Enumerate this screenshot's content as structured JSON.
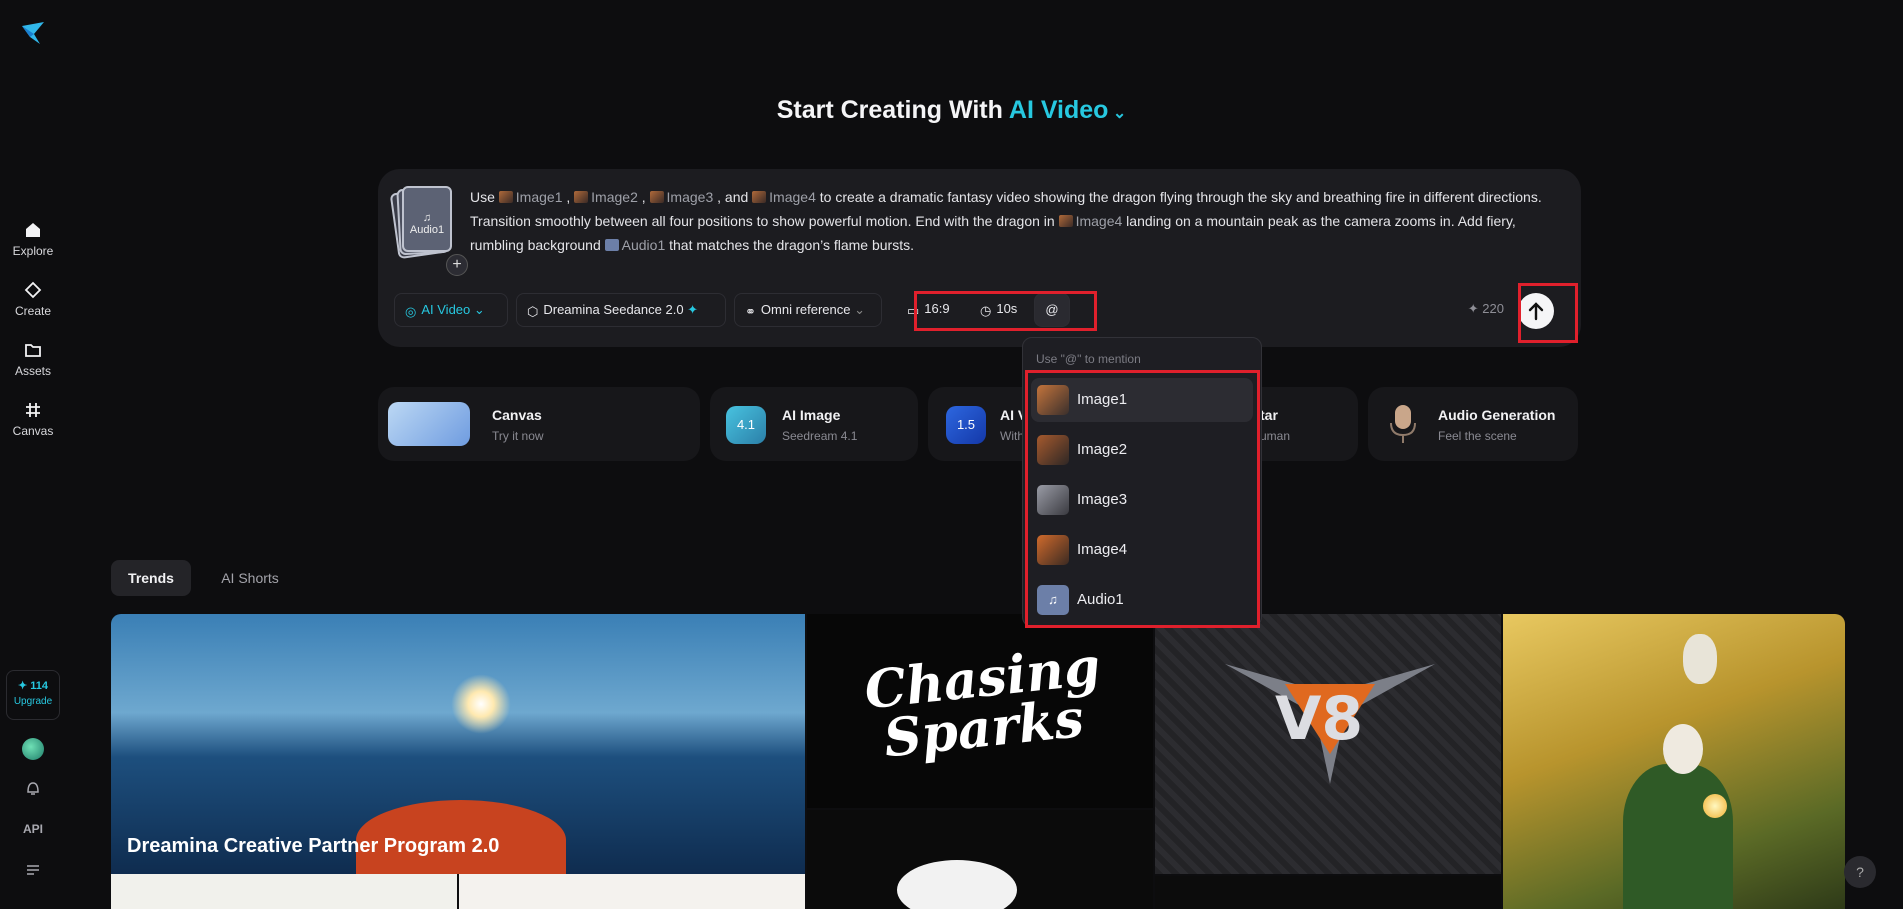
{
  "sidebar": {
    "items": [
      {
        "label": "Explore",
        "icon": "home-icon"
      },
      {
        "label": "Create",
        "icon": "diamond-icon"
      },
      {
        "label": "Assets",
        "icon": "folder-icon"
      },
      {
        "label": "Canvas",
        "icon": "grid-icon"
      }
    ],
    "credits": "114",
    "upgrade_label": "Upgrade",
    "api_label": "API"
  },
  "headline": {
    "prefix": "Start Creating With",
    "accent": "AI Video"
  },
  "prompt": {
    "audio_thumb_label": "Audio1",
    "seg1": "Use",
    "ref_image1": "Image1",
    "ref_image2": "Image2",
    "ref_image3": "Image3",
    "ref_image4": "Image4",
    "ref_audio1": "Audio1",
    "seg2": ", and",
    "seg3": "to create a dramatic fantasy video showing the dragon flying through the sky and breathing fire in different dir",
    "seg4": "ections. Transition smoothly between all four positions to show powerful motion. End with the dragon in",
    "seg5": "landing on a mountain peak as the camera zooms in.",
    "seg6": "Add fiery, rumbling background",
    "seg7": "that matches the dragon’s flame bursts."
  },
  "toolbar": {
    "mode": "AI Video",
    "model": "Dreamina Seedance 2.0",
    "reference": "Omni reference",
    "ratio": "16:9",
    "duration": "10s",
    "mention": "@",
    "credit_cost": "220"
  },
  "features": [
    {
      "title": "Canvas",
      "sub": "Try it now"
    },
    {
      "title": "AI Image",
      "sub": "Seedream 4.1",
      "badge": "4.1"
    },
    {
      "title": "AI V",
      "sub": "With",
      "badge": "1.5"
    },
    {
      "title": "tar",
      "sub": "uman"
    },
    {
      "title": "Audio Generation",
      "sub": "Feel the scene"
    }
  ],
  "tabs": [
    "Trends",
    "AI Shorts"
  ],
  "gallery": {
    "banner_title": "Dreamina Creative Partner Program 2.0",
    "sparks_line1": "Chasing",
    "sparks_line2": "Sparks",
    "v8_text": "V8"
  },
  "mention_menu": {
    "hint": "Use \"@\" to mention",
    "items": [
      "Image1",
      "Image2",
      "Image3",
      "Image4",
      "Audio1"
    ]
  },
  "colors": {
    "accent": "#27c8e0",
    "highlight": "#e0202c",
    "panel": "#1c1c20"
  }
}
